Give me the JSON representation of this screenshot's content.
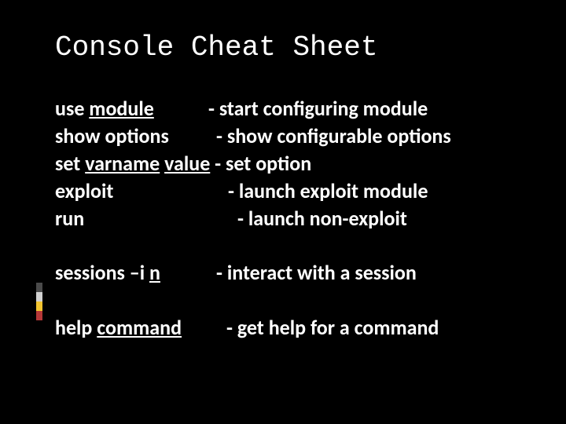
{
  "title": "Console Cheat Sheet",
  "rows": [
    {
      "cmd_pre": "use ",
      "cmd_arg": "module",
      "cmd_post": "",
      "sep": "- ",
      "desc": "start configuring module"
    },
    {
      "cmd_pre": "show options",
      "cmd_arg": "",
      "cmd_post": "",
      "sep": "- ",
      "desc": "show configurable options"
    },
    {
      "cmd_pre": "set ",
      "cmd_arg": "varname",
      "cmd_post": " ",
      "cmd_arg2": "value",
      "sep": " - ",
      "desc": "set option"
    },
    {
      "cmd_pre": "exploit",
      "cmd_arg": "",
      "cmd_post": "",
      "sep": "- ",
      "desc": "launch exploit module"
    },
    {
      "cmd_pre": "run",
      "cmd_arg": "",
      "cmd_post": "",
      "sep": "- ",
      "desc": "launch non-exploit"
    },
    {
      "cmd_pre": "sessions –i ",
      "cmd_arg": "n",
      "cmd_post": "",
      "sep": "- ",
      "desc": "interact with a session"
    },
    {
      "cmd_pre": "help ",
      "cmd_arg": "command",
      "cmd_post": "",
      "sep": "- ",
      "desc": "get help for a command"
    }
  ],
  "cmd_widths": [
    195,
    205,
    0,
    220,
    232,
    205,
    218
  ],
  "accent_colors": [
    "#4a4a4a",
    "#d0d0d0",
    "#f2c430",
    "#b53838"
  ]
}
